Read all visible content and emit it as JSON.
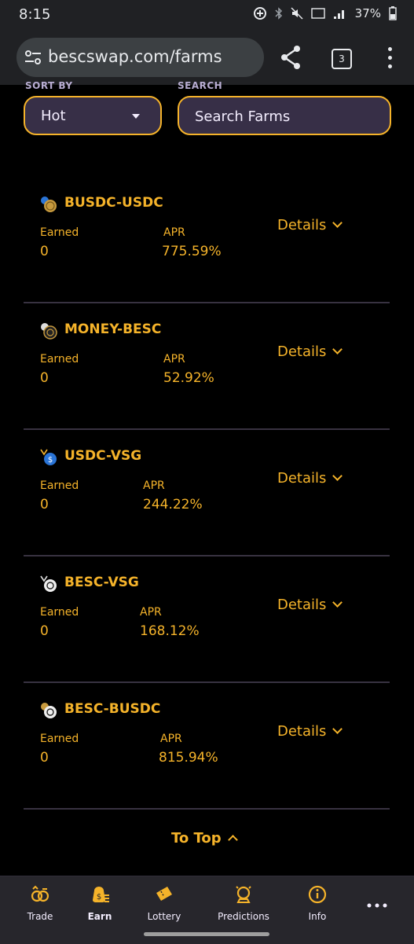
{
  "status": {
    "time": "8:15",
    "battery": "37%"
  },
  "browser": {
    "url": "bescswap.com/farms",
    "tab_count": "3"
  },
  "filters": {
    "sort_label": "SORT BY",
    "sort_value": "Hot",
    "search_label": "SEARCH",
    "search_placeholder": "Search Farms"
  },
  "farms": [
    {
      "pair": "BUSDC-USDC",
      "earned_label": "Earned",
      "earned": "0",
      "apr_label": "APR",
      "apr": "775.59%",
      "details": "Details"
    },
    {
      "pair": "MONEY-BESC",
      "earned_label": "Earned",
      "earned": "0",
      "apr_label": "APR",
      "apr": "52.92%",
      "details": "Details"
    },
    {
      "pair": "USDC-VSG",
      "earned_label": "Earned",
      "earned": "0",
      "apr_label": "APR",
      "apr": "244.22%",
      "details": "Details"
    },
    {
      "pair": "BESC-VSG",
      "earned_label": "Earned",
      "earned": "0",
      "apr_label": "APR",
      "apr": "168.12%",
      "details": "Details"
    },
    {
      "pair": "BESC-BUSDC",
      "earned_label": "Earned",
      "earned": "0",
      "apr_label": "APR",
      "apr": "815.94%",
      "details": "Details"
    }
  ],
  "to_top": "To Top",
  "nav": [
    {
      "label": "Trade",
      "icon": "trade-icon"
    },
    {
      "label": "Earn",
      "icon": "earn-icon"
    },
    {
      "label": "Lottery",
      "icon": "lottery-icon"
    },
    {
      "label": "Predictions",
      "icon": "predictions-icon"
    },
    {
      "label": "Info",
      "icon": "info-icon"
    },
    {
      "label": "",
      "icon": "more-icon"
    }
  ],
  "colors": {
    "accent": "#f5b32a",
    "input_bg": "#372f47",
    "nav_bg": "#27262c",
    "page_bg": "#000000"
  }
}
